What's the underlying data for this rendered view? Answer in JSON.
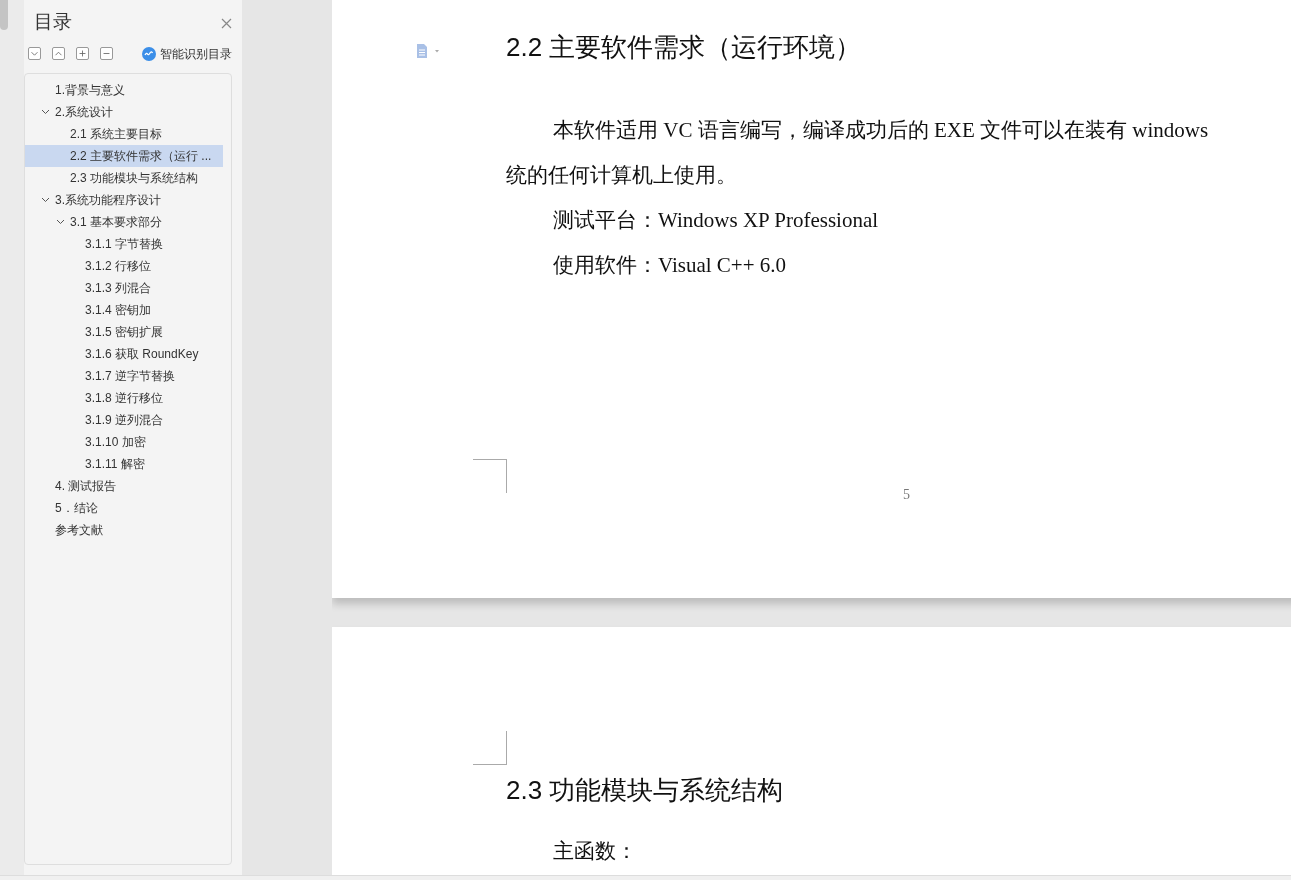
{
  "sidebar": {
    "title": "目录",
    "toolbar": [
      {
        "kind": "expand"
      },
      {
        "kind": "collapse"
      },
      {
        "kind": "add"
      },
      {
        "kind": "remove"
      }
    ],
    "smart_toc": "智能识别目录",
    "items": [
      {
        "label": "1.背景与意义",
        "selected": false
      },
      {
        "label": "2.系统设计",
        "selected": false,
        "expanded": true,
        "children": [
          {
            "label": "2.1 系统主要目标",
            "selected": false
          },
          {
            "label": "2.2 主要软件需求（运行 ...",
            "selected": true
          },
          {
            "label": "2.3 功能模块与系统结构",
            "selected": false
          }
        ]
      },
      {
        "label": "3.系统功能程序设计",
        "selected": false,
        "expanded": true,
        "children": [
          {
            "label": "3.1 基本要求部分",
            "selected": false,
            "expanded": true,
            "children": [
              {
                "label": "3.1.1  字节替换",
                "selected": false
              },
              {
                "label": "3.1.2 行移位",
                "selected": false
              },
              {
                "label": "3.1.3 列混合",
                "selected": false
              },
              {
                "label": "3.1.4 密钥加",
                "selected": false
              },
              {
                "label": "3.1.5 密钥扩展",
                "selected": false
              },
              {
                "label": "3.1.6 获取 RoundKey",
                "selected": false
              },
              {
                "label": "3.1.7 逆字节替换",
                "selected": false
              },
              {
                "label": "3.1.8 逆行移位",
                "selected": false
              },
              {
                "label": "3.1.9 逆列混合",
                "selected": false
              },
              {
                "label": "3.1.10 加密",
                "selected": false
              },
              {
                "label": "3.1.11 解密",
                "selected": false
              }
            ]
          }
        ]
      },
      {
        "label": "4. 测试报告",
        "selected": false
      },
      {
        "label": "5．结论",
        "selected": false
      },
      {
        "label": "参考文献",
        "selected": false
      }
    ]
  },
  "document": {
    "pages": [
      {
        "blocks": [
          {
            "kind": "heading",
            "text": "2.2 主要软件需求（运行环境）"
          },
          {
            "kind": "paragraph",
            "lines": [
              "本软件适用 VC 语言编写，编译成功后的 EXE 文件可以在装有 windows",
              "统的任何计算机上使用。"
            ]
          },
          {
            "kind": "paragraph",
            "lines": [
              "测试平台：Windows XP Professional"
            ]
          },
          {
            "kind": "paragraph",
            "lines": [
              "使用软件：Visual C++ 6.0"
            ]
          }
        ],
        "page_number": "5"
      },
      {
        "blocks": [
          {
            "kind": "heading",
            "text": "2.3 功能模块与系统结构"
          },
          {
            "kind": "paragraph",
            "lines": [
              "主函数："
            ]
          }
        ]
      }
    ]
  }
}
